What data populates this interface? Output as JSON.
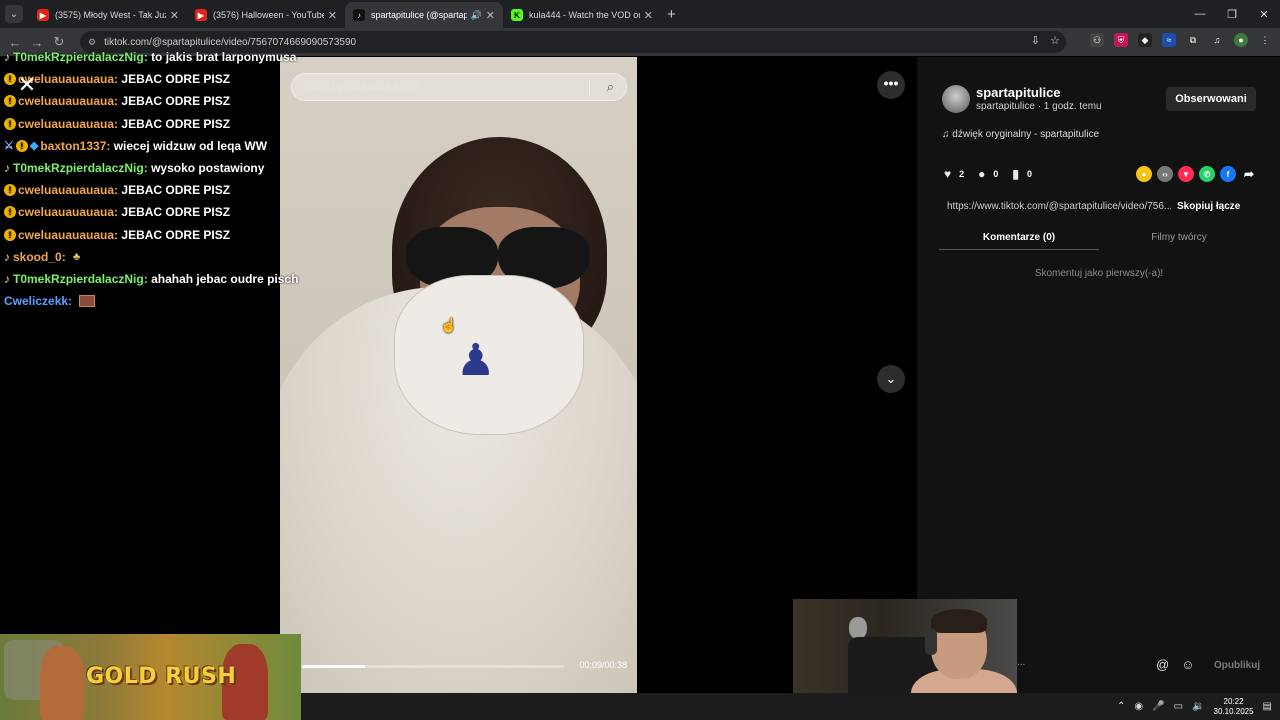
{
  "tabs": [
    {
      "title": "(3575) Młody West - Tak Już By",
      "favicon_color": "#e62117",
      "active": false
    },
    {
      "title": "(3576) Halloween - YouTube",
      "favicon_color": "#e62117",
      "active": false
    },
    {
      "title": "spartapitulice (@spartapitu",
      "favicon_color": "#111111",
      "active": true
    },
    {
      "title": "kula444 - Watch the VOD on K",
      "favicon_color": "#53fc18",
      "active": false
    }
  ],
  "address": {
    "url": "tiktok.com/@spartapitulice/video/7567074669090573590"
  },
  "chat": [
    {
      "badge": "note",
      "user": "T0mekRzpierdalaczNig",
      "color": "green",
      "msg": "to jakis brat larponymusa"
    },
    {
      "badge": "coin",
      "user": "cweluauauauaua",
      "color": "orange",
      "msg": "JEBAC ODRE PISZ"
    },
    {
      "badge": "coin",
      "user": "cweluauauauaua",
      "color": "orange",
      "msg": "JEBAC ODRE PISZ"
    },
    {
      "badge": "coin",
      "user": "cweluauauauaua",
      "color": "orange",
      "msg": "JEBAC ODRE PISZ"
    },
    {
      "badge": "multi",
      "user": "baxton1337",
      "color": "orange",
      "msg": "wiecej widzuw od leqa WW"
    },
    {
      "badge": "note",
      "user": "T0mekRzpierdalaczNig",
      "color": "green",
      "msg": "wysoko postawiony"
    },
    {
      "badge": "coin",
      "user": "cweluauauauaua",
      "color": "orange",
      "msg": "JEBAC ODRE PISZ"
    },
    {
      "badge": "coin",
      "user": "cweluauauauaua",
      "color": "orange",
      "msg": "JEBAC ODRE PISZ"
    },
    {
      "badge": "coin",
      "user": "cweluauauauaua",
      "color": "orange",
      "msg": "JEBAC ODRE PISZ"
    },
    {
      "badge": "note",
      "user": "skood_0",
      "color": "orange",
      "msg": ""
    },
    {
      "badge": "note",
      "user": "T0mekRzpierdalaczNig",
      "color": "green",
      "msg": "ahahah jebac oudre pisch"
    },
    {
      "badge": "none",
      "user": "Cweliczekk",
      "color": "blue",
      "msg": ""
    }
  ],
  "video": {
    "search_placeholder": "Znajdź powiązane treści",
    "timecode": "00:09/00:38",
    "progress": 0.24
  },
  "panel": {
    "username": "spartapitulice",
    "subline": "spartapitulice · 1 godz. temu",
    "follow_label": "Obserwowani",
    "sound": "dźwięk oryginalny - spartapitulice",
    "likes": "2",
    "comments": "0",
    "saves": "0",
    "link": "https://www.tiktok.com/@spartapitulice/video/756...",
    "copy_label": "Skopiuj łącze",
    "tab_comments": "Komentarze (0)",
    "tab_creator": "Filmy twórcy",
    "empty_text": "Skomentuj jako pierwszy(-a)!",
    "post_label": "Opublikuj",
    "ellipsis": "..."
  },
  "banner": {
    "title": "GOLD RUSH"
  },
  "taskbar": {
    "time": "20:22",
    "date": "30.10.2025"
  },
  "colors": {
    "green_user": "#7cf06a",
    "orange_user": "#f2a64d",
    "blue_user": "#5aa0ff"
  }
}
